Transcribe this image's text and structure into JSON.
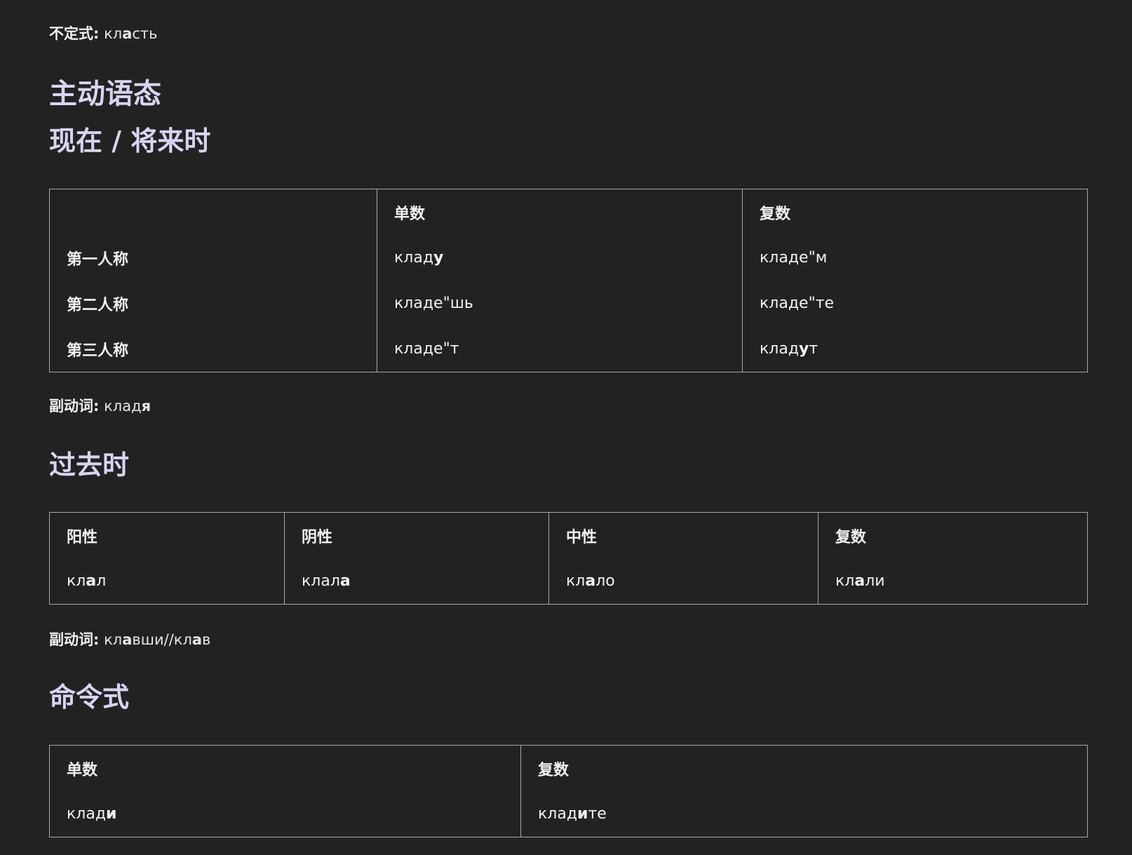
{
  "infinitive": {
    "label": "不定式:",
    "pre": "кл",
    "stress": "а",
    "post": "сть"
  },
  "headings": {
    "active_voice": "主动语态",
    "present_future": "现在 / 将来时",
    "past": "过去时",
    "imperative": "命令式"
  },
  "present_table": {
    "col_singular": "单数",
    "col_plural": "复数",
    "rows": [
      {
        "person": "第一人称",
        "sg": {
          "pre": "клад",
          "stress": "у",
          "post": ""
        },
        "pl": {
          "pre": "кладе\"м",
          "stress": "",
          "post": ""
        }
      },
      {
        "person": "第二人称",
        "sg": {
          "pre": "кладе\"шь",
          "stress": "",
          "post": ""
        },
        "pl": {
          "pre": "кладе\"те",
          "stress": "",
          "post": ""
        }
      },
      {
        "person": "第三人称",
        "sg": {
          "pre": "кладе\"т",
          "stress": "",
          "post": ""
        },
        "pl": {
          "pre": "клад",
          "stress": "у",
          "post": "т"
        }
      }
    ]
  },
  "present_gerund": {
    "label": "副动词:",
    "pre": "клад",
    "stress": "я",
    "post": ""
  },
  "past_table": {
    "cols": [
      "阳性",
      "阴性",
      "中性",
      "复数"
    ],
    "values": [
      {
        "pre": "кл",
        "stress": "а",
        "post": "л"
      },
      {
        "pre": "клал",
        "stress": "а",
        "post": ""
      },
      {
        "pre": "кл",
        "stress": "а",
        "post": "ло"
      },
      {
        "pre": "кл",
        "stress": "а",
        "post": "ли"
      }
    ]
  },
  "past_gerund": {
    "label": "副动词:",
    "pre": "кл",
    "stress": "а",
    "mid": "вши//кл",
    "stress2": "а",
    "post": "в"
  },
  "imperative_table": {
    "col_singular": "单数",
    "col_plural": "复数",
    "sg": {
      "pre": "клад",
      "stress": "и",
      "post": ""
    },
    "pl": {
      "pre": "клад",
      "stress": "и",
      "post": "те"
    }
  }
}
